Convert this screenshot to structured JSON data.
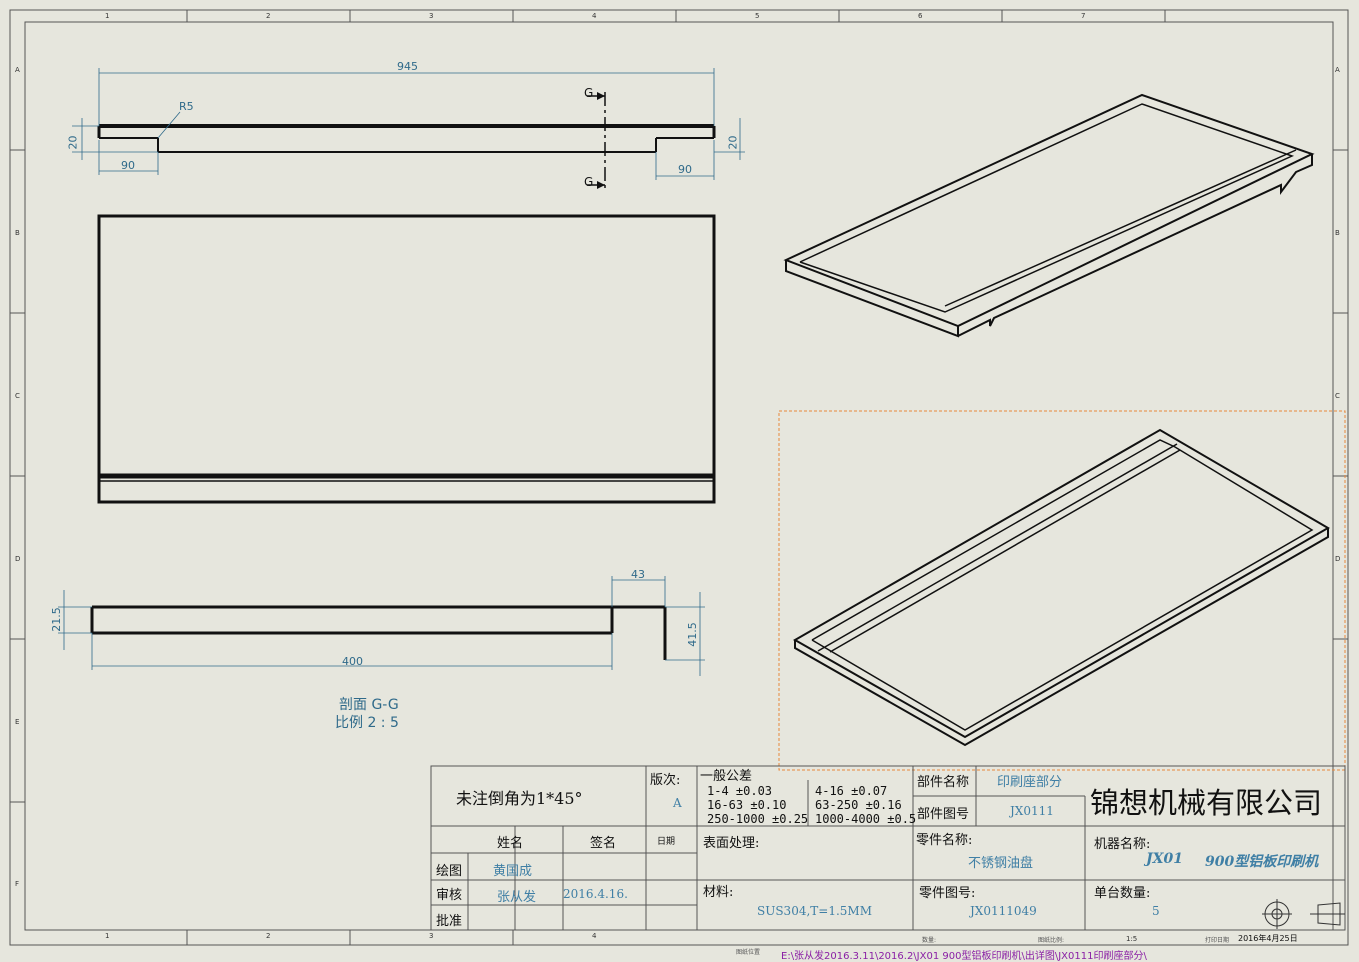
{
  "zones": {
    "cols": [
      "1",
      "2",
      "3",
      "4",
      "5",
      "6",
      "7"
    ],
    "rows": [
      "A",
      "B",
      "C",
      "D",
      "E",
      "F"
    ]
  },
  "dims": {
    "top_len": "945",
    "r5": "R5",
    "h20_left": "20",
    "h20_right": "20",
    "w90_left": "90",
    "w90_right": "90",
    "sec_g_top": "G",
    "sec_g_bot": "G",
    "sec_21_5": "21.5",
    "sec_400": "400",
    "sec_43": "43",
    "sec_41_5": "41.5"
  },
  "section_caption": {
    "line1": "剖面 G-G",
    "line2": "比例 2 : 5"
  },
  "title_block": {
    "note": "未注倒角为1*45°",
    "version_label": "版次:",
    "version_value": "A",
    "tolerance_title": "一般公差",
    "tol_1": "1-4  ±0.03",
    "tol_2": "16-63 ±0.10",
    "tol_3": "250-1000 ±0.25",
    "tol_4": "4-16 ±0.07",
    "tol_5": "63-250 ±0.16",
    "tol_6": "1000-4000 ±0.5",
    "part_name_label": "部件名称",
    "part_name_value": "印刷座部分",
    "part_no_label": "部件图号",
    "part_no_value": "JX0111",
    "company": "锦想机械有限公司",
    "col_name": "姓名",
    "col_sign": "签名",
    "col_date": "日期",
    "row_draw": "绘图",
    "row_check": "审核",
    "row_approve": "批准",
    "drawer": "黄国成",
    "checker": "张从发",
    "check_date": "2016.4.16.",
    "surface_label": "表面处理:",
    "material_label": "材料:",
    "material_value": "SUS304,T=1.5MM",
    "component_name_label": "零件名称:",
    "component_name_value": "不锈钢油盘",
    "component_no_label": "零件图号:",
    "component_no_value": "JX0111049",
    "machine_label": "机器名称:",
    "machine_code": "JX01",
    "machine_name": "900型铝板印刷机",
    "qty_label": "单台数量:",
    "qty_value": "5"
  },
  "status": {
    "left_label": "图纸位置",
    "path": "E:\\张从发2016.3.11\\2016.2\\JX01   900型铝板印刷机\\出详图\\JX0111印刷座部分\\",
    "scale_label": "图纸比例:",
    "scale_value": "1:5",
    "date_label": "打印日期",
    "date_value": "2016年4月25日",
    "qty_label": "数量:"
  },
  "colors": {
    "background": "#e6e6dd",
    "dimension": "#2f6a8a",
    "selection": "#e8883a",
    "status_path": "#8a1fa5"
  }
}
